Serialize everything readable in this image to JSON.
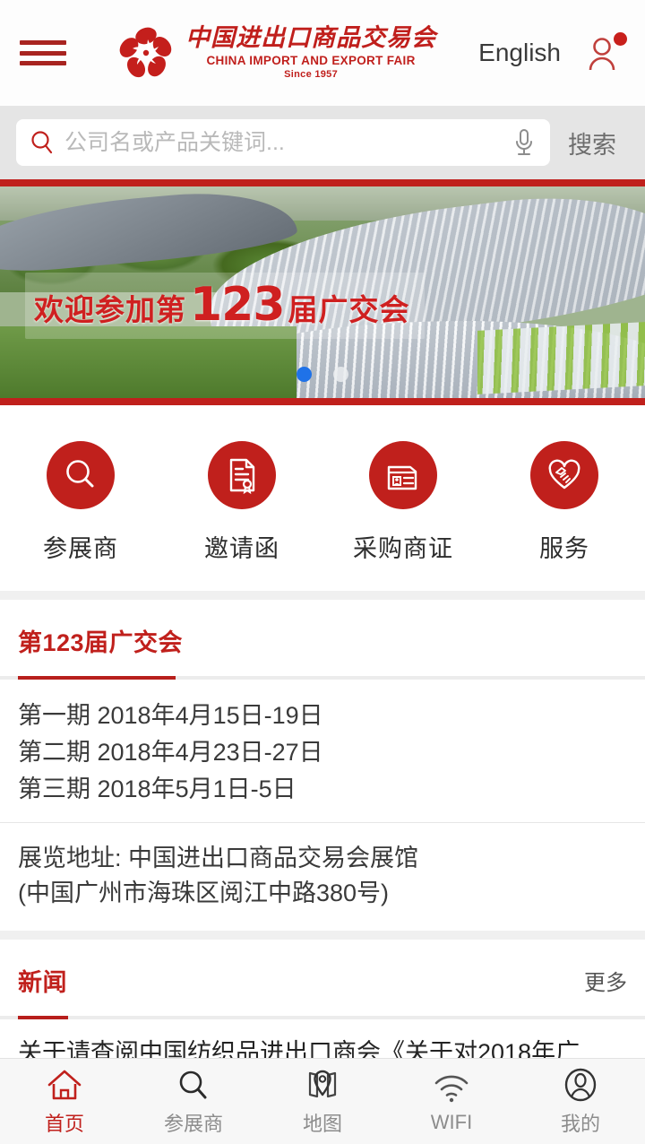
{
  "header": {
    "menu_label": "menu",
    "logo_cn": "中国进出口商品交易会",
    "logo_en": "CHINA IMPORT AND EXPORT FAIR",
    "logo_since": "Since 1957",
    "language_button": "English",
    "account_icon": "user-icon",
    "badge_visible": true
  },
  "search": {
    "placeholder": "公司名或产品关键词...",
    "value": "",
    "mic_icon": "microphone-icon",
    "submit_label": "搜索"
  },
  "banner": {
    "caption_prefix": "欢迎参加第",
    "caption_number": "123",
    "caption_suffix": "届广交会",
    "slides": 2,
    "active_slide": 1,
    "active_dot_color": "#1f72e8",
    "inactive_dot_color": "#ebeef0",
    "border_color": "#c0201c"
  },
  "quick_links": [
    {
      "label": "参展商",
      "icon": "search-magnifier-icon"
    },
    {
      "label": "邀请函",
      "icon": "invitation-document-icon"
    },
    {
      "label": "采购商证",
      "icon": "id-card-icon"
    },
    {
      "label": "服务",
      "icon": "handshake-heart-icon"
    }
  ],
  "fair_section": {
    "title": "第123届广交会",
    "schedule": [
      "第一期 2018年4月15日-19日",
      "第二期 2018年4月23日-27日",
      "第三期 2018年5月1日-5日"
    ],
    "address_lines": [
      "展览地址: 中国进出口商品交易会展馆",
      "(中国广州市海珠区阅江中路380号)"
    ]
  },
  "news_section": {
    "title": "新闻",
    "more_label": "更多",
    "items": [
      "关于请查阅中国纺织品进出口商会《关于对2018年广"
    ]
  },
  "tabbar": [
    {
      "label": "首页",
      "icon": "home-icon",
      "active": true
    },
    {
      "label": "参展商",
      "icon": "search-icon",
      "active": false
    },
    {
      "label": "地图",
      "icon": "map-pin-icon",
      "active": false
    },
    {
      "label": "WIFI",
      "icon": "wifi-icon",
      "active": false
    },
    {
      "label": "我的",
      "icon": "profile-icon",
      "active": false
    }
  ],
  "colors": {
    "brand_red": "#c0201c",
    "dark_red": "#a82420",
    "text": "#2d2d2d",
    "muted": "#8c8c8c",
    "search_bg": "#e5e5e5"
  }
}
